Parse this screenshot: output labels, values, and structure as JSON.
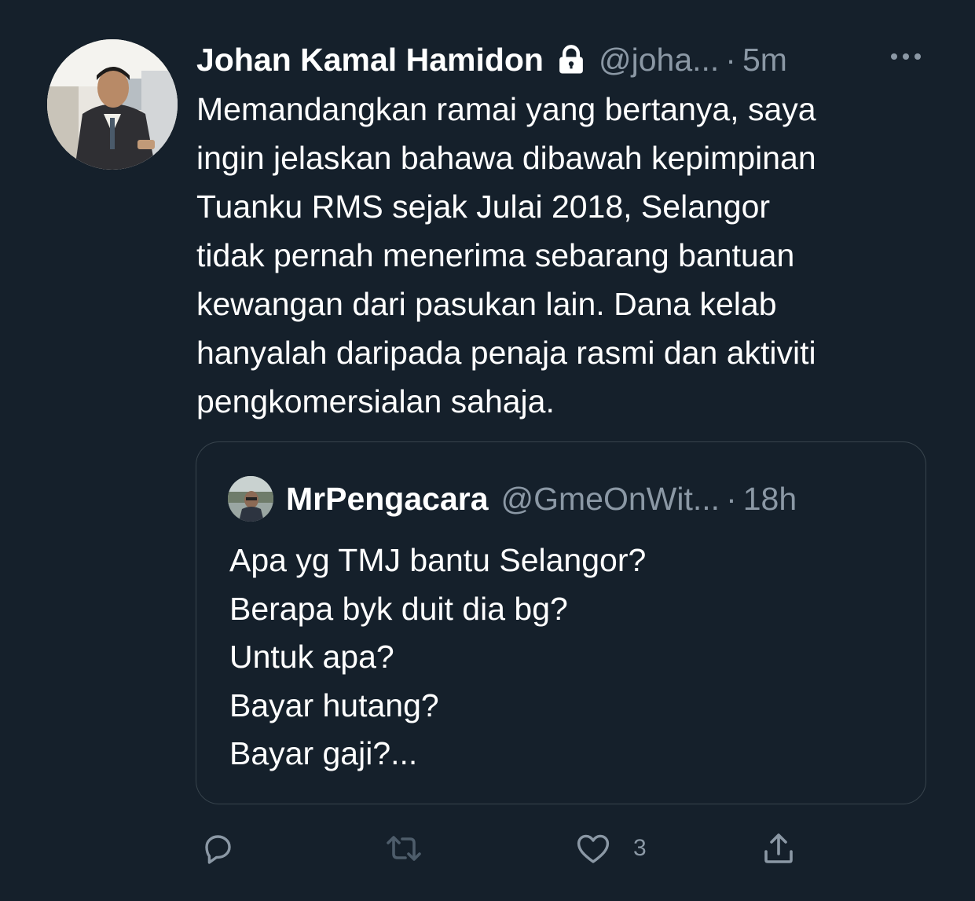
{
  "tweet": {
    "display_name": "Johan Kamal Hamidon",
    "handle": "@joha...",
    "separator": "·",
    "time": "5m",
    "text_lines": [
      "Memandangkan ramai yang bertanya, saya",
      "ingin jelaskan bahawa dibawah kepimpinan",
      "Tuanku RMS sejak Julai 2018, Selangor",
      "tidak pernah menerima sebarang bantuan",
      "kewangan dari pasukan lain. Dana kelab",
      "hanyalah daripada penaja rasmi dan aktiviti",
      "pengkomersialan sahaja."
    ],
    "icons": {
      "lock": "lock-icon",
      "more": "more-icon"
    }
  },
  "quoted_tweet": {
    "display_name": "MrPengacara",
    "handle": "@GmeOnWit...",
    "separator": "·",
    "time": "18h",
    "text_lines": [
      "Apa yg TMJ bantu Selangor?",
      "Berapa byk duit dia bg?",
      "Untuk apa?",
      "Bayar hutang?",
      "Bayar gaji?..."
    ]
  },
  "actions": {
    "reply_icon": "reply-icon",
    "retweet_icon": "retweet-icon",
    "like_icon": "heart-icon",
    "like_count": "3",
    "share_icon": "share-icon"
  },
  "colors": {
    "background": "#15202b",
    "text_primary": "#ffffff",
    "text_secondary": "#8b98a5",
    "border": "#38444d"
  }
}
